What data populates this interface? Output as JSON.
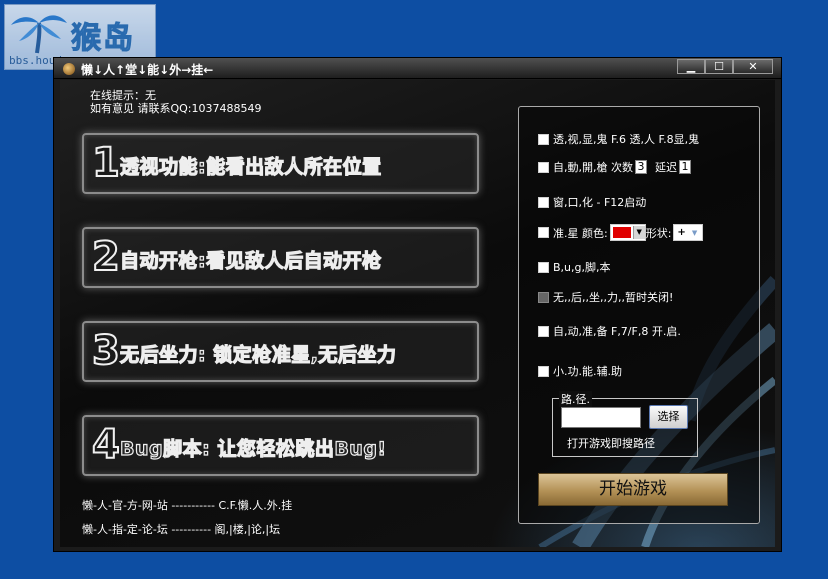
{
  "watermark": {
    "brand": "猴岛",
    "url": "bbs.houdao.com"
  },
  "window": {
    "title": "懒↓人↑堂↓能↓外→挂←",
    "btn_min": "▁",
    "btn_max": "☐",
    "btn_close": "✕"
  },
  "notice": {
    "line1": "在线提示：无",
    "line2": "如有意见 请联系QQ:1037488549"
  },
  "features": [
    {
      "num": "1",
      "text": "透视功能:能看出敌人所在位置"
    },
    {
      "num": "2",
      "text": "自动开枪:看见敌人后自动开枪"
    },
    {
      "num": "3",
      "text": "无后坐力: 锁定枪准星,无后坐力"
    },
    {
      "num": "4",
      "text": "Bug脚本: 让您轻松跳出Bug!"
    }
  ],
  "links": {
    "site": "懒-人-官-方-网-站 ----------- C.F.懒.人.外.挂",
    "forum": "懒-人-指-定-论-坛 ----------  阁,|楼,|论,|坛"
  },
  "options": {
    "opt1": "透,视,显,鬼 F.6 透,人 F.8显,鬼",
    "opt2_label": "自,動,開,槍 次数",
    "opt2_count": "3",
    "opt2_delay_label": "延迟",
    "opt2_delay": "1",
    "opt3": "窗,口,化 - F12启动",
    "opt4_label": "准.星 颜色:",
    "opt4_shape_label": "形状:",
    "opt4_shape_value": "+",
    "opt5": "B,u,g,脚,本",
    "opt6": "无,,后,,坐,,力,,暂时关闭!",
    "opt7": "自,动,准,备 F,7/F,8 开.启.",
    "opt8": "小.功.能.辅.助"
  },
  "path": {
    "legend": "路.径.",
    "browse": "选择",
    "hint": "打开游戏即搜路径"
  },
  "start_button": "开始游戏",
  "colors": {
    "crosshair_color": "#e00000",
    "desktop": "#0d4ea3",
    "button_gold": "#b39156"
  }
}
